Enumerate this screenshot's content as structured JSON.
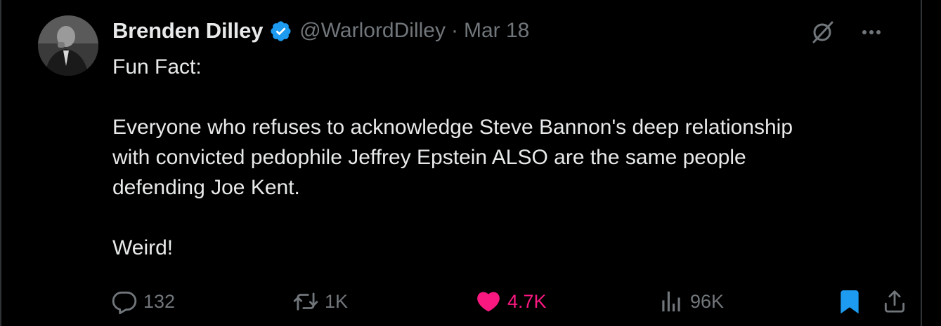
{
  "author": {
    "display_name": "Brenden Dilley",
    "handle": "@WarlordDilley",
    "separator": "·",
    "date": "Mar 18",
    "verified": true
  },
  "tweet": {
    "text": "Fun Fact:\n\nEveryone who refuses to acknowledge Steve Bannon's deep relationship\nwith convicted pedophile Jeffrey Epstein ALSO are the same people\ndefending Joe Kent.\n\nWeird!"
  },
  "actions": {
    "reply": {
      "icon": "reply-icon",
      "count": "132"
    },
    "repost": {
      "icon": "repost-icon",
      "count": "1K"
    },
    "like": {
      "icon": "heart-icon",
      "count": "4.7K",
      "liked": true
    },
    "views": {
      "icon": "views-icon",
      "count": "96K"
    },
    "bookmark": {
      "icon": "bookmark-icon",
      "bookmarked": true
    },
    "share": {
      "icon": "share-icon"
    }
  },
  "header_icons": [
    "grok-icon",
    "more-icon"
  ],
  "colors": {
    "background": "#000000",
    "text_primary": "#e7e9ea",
    "text_secondary": "#71767b",
    "verified_blue": "#1d9bf0",
    "like_pink": "#f91880",
    "bookmark_blue": "#1d9bf0",
    "border": "#2f3336"
  }
}
